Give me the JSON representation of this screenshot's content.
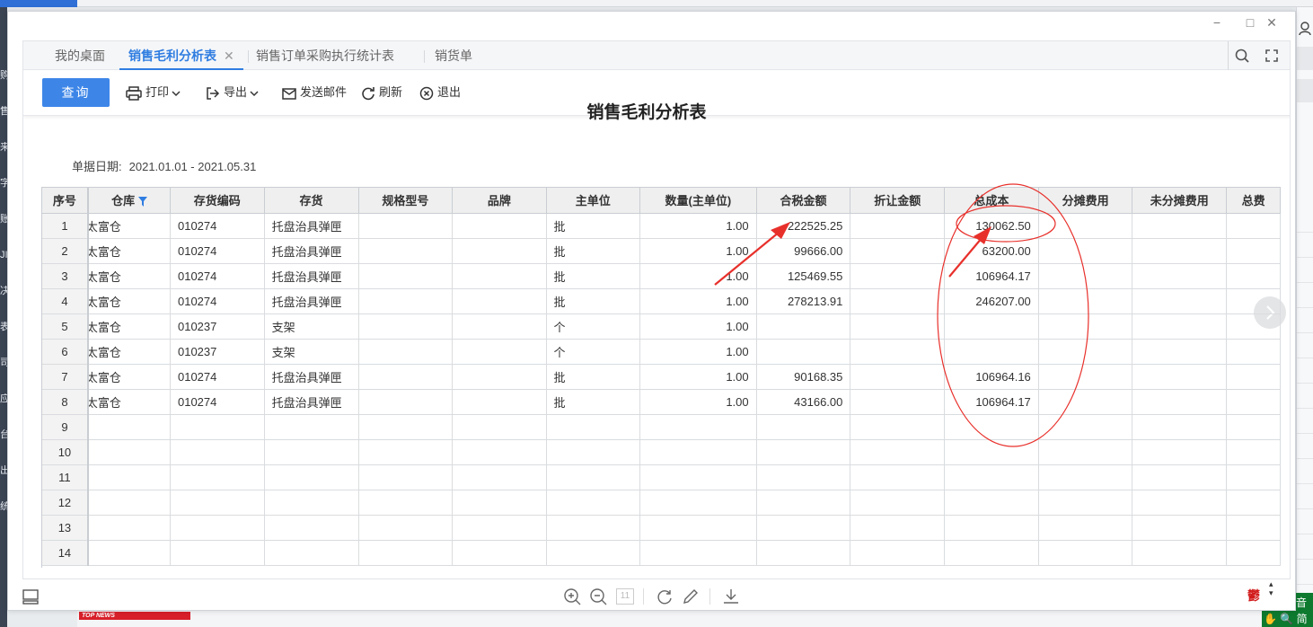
{
  "background": {
    "left_strip": [
      "购",
      "售",
      "来",
      "字",
      "账",
      "JI",
      "决",
      "表",
      "司",
      "应",
      "台",
      "出",
      "统"
    ]
  },
  "tabs": [
    {
      "label": "我的桌面",
      "active": false
    },
    {
      "label": "销售毛利分析表",
      "active": true,
      "closable": true,
      "close_glyph": "✕"
    },
    {
      "label": "销售订单采购执行统计表",
      "active": false
    },
    {
      "label": "销货单",
      "active": false
    }
  ],
  "toolbar": {
    "query_label": "查询",
    "print_label": "打印",
    "export_label": "导出",
    "email_label": "发送邮件",
    "refresh_label": "刷新",
    "exit_label": "退出"
  },
  "report": {
    "title": "销售毛利分析表",
    "date_label": "单据日期:",
    "date_value": "2021.01.01 - 2021.05.31"
  },
  "table": {
    "columns": [
      "序号",
      "仓库",
      "存货编码",
      "存货",
      "规格型号",
      "品牌",
      "主单位",
      "数量(主单位)",
      "合税金额",
      "折让金额",
      "总成本",
      "分摊费用",
      "未分摊费用",
      "总费"
    ],
    "rows": [
      {
        "seq": "1",
        "warehouse": "太富仓",
        "code": "010274",
        "item": "托盘治具弹匣",
        "spec": "",
        "brand": "",
        "unit": "批",
        "qty": "1.00",
        "tax_amount": "222525.25",
        "discount": "",
        "total_cost": "130062.50",
        "allocated": "",
        "unallocated": "",
        "total_fee": ""
      },
      {
        "seq": "2",
        "warehouse": "太富仓",
        "code": "010274",
        "item": "托盘治具弹匣",
        "spec": "",
        "brand": "",
        "unit": "批",
        "qty": "1.00",
        "tax_amount": "99666.00",
        "discount": "",
        "total_cost": "63200.00",
        "allocated": "",
        "unallocated": "",
        "total_fee": ""
      },
      {
        "seq": "3",
        "warehouse": "太富仓",
        "code": "010274",
        "item": "托盘治具弹匣",
        "spec": "",
        "brand": "",
        "unit": "批",
        "qty": "1.00",
        "tax_amount": "125469.55",
        "discount": "",
        "total_cost": "106964.17",
        "allocated": "",
        "unallocated": "",
        "total_fee": ""
      },
      {
        "seq": "4",
        "warehouse": "太富仓",
        "code": "010274",
        "item": "托盘治具弹匣",
        "spec": "",
        "brand": "",
        "unit": "批",
        "qty": "1.00",
        "tax_amount": "278213.91",
        "discount": "",
        "total_cost": "246207.00",
        "allocated": "",
        "unallocated": "",
        "total_fee": ""
      },
      {
        "seq": "5",
        "warehouse": "太富仓",
        "code": "010237",
        "item": "支架",
        "spec": "",
        "brand": "",
        "unit": "个",
        "qty": "1.00",
        "tax_amount": "",
        "discount": "",
        "total_cost": "",
        "allocated": "",
        "unallocated": "",
        "total_fee": ""
      },
      {
        "seq": "6",
        "warehouse": "太富仓",
        "code": "010237",
        "item": "支架",
        "spec": "",
        "brand": "",
        "unit": "个",
        "qty": "1.00",
        "tax_amount": "",
        "discount": "",
        "total_cost": "",
        "allocated": "",
        "unallocated": "",
        "total_fee": ""
      },
      {
        "seq": "7",
        "warehouse": "太富仓",
        "code": "010274",
        "item": "托盘治具弹匣",
        "spec": "",
        "brand": "",
        "unit": "批",
        "qty": "1.00",
        "tax_amount": "90168.35",
        "discount": "",
        "total_cost": "106964.16",
        "allocated": "",
        "unallocated": "",
        "total_fee": ""
      },
      {
        "seq": "8",
        "warehouse": "太富仓",
        "code": "010274",
        "item": "托盘治具弹匣",
        "spec": "",
        "brand": "",
        "unit": "批",
        "qty": "1.00",
        "tax_amount": "43166.00",
        "discount": "",
        "total_cost": "106964.17",
        "allocated": "",
        "unallocated": "",
        "total_fee": ""
      },
      {
        "seq": "9"
      },
      {
        "seq": "10"
      },
      {
        "seq": "11"
      },
      {
        "seq": "12"
      },
      {
        "seq": "13"
      },
      {
        "seq": "14"
      }
    ]
  },
  "pager": {
    "page_box": "11"
  },
  "bottom_banner": "TOP NEWS",
  "ime": {
    "row1": "五笔拼音",
    "row2": "简"
  },
  "stamp_glyph": "鬱",
  "colors": {
    "accent": "#2f7de1",
    "query_button": "#3d86e8",
    "annotation": "#e8302b"
  }
}
